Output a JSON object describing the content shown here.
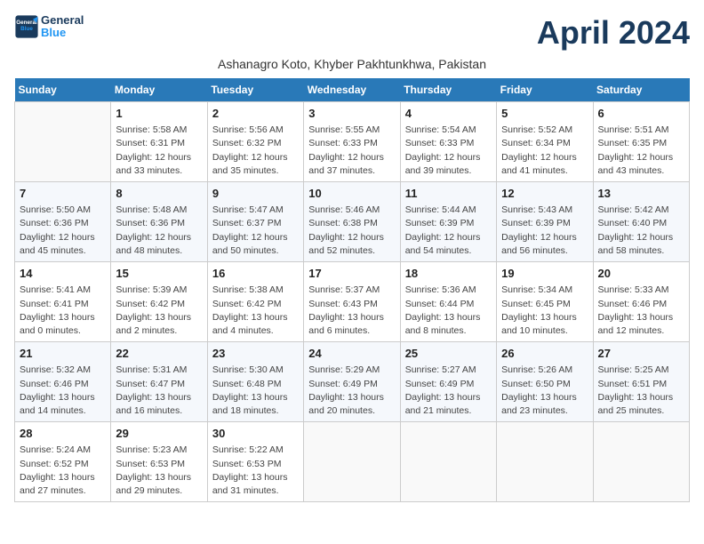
{
  "header": {
    "logo_line1": "General",
    "logo_line2": "Blue",
    "month_title": "April 2024",
    "subtitle": "Ashanagro Koto, Khyber Pakhtunkhwa, Pakistan"
  },
  "columns": [
    "Sunday",
    "Monday",
    "Tuesday",
    "Wednesday",
    "Thursday",
    "Friday",
    "Saturday"
  ],
  "weeks": [
    [
      {
        "day": "",
        "info": ""
      },
      {
        "day": "1",
        "info": "Sunrise: 5:58 AM\nSunset: 6:31 PM\nDaylight: 12 hours\nand 33 minutes."
      },
      {
        "day": "2",
        "info": "Sunrise: 5:56 AM\nSunset: 6:32 PM\nDaylight: 12 hours\nand 35 minutes."
      },
      {
        "day": "3",
        "info": "Sunrise: 5:55 AM\nSunset: 6:33 PM\nDaylight: 12 hours\nand 37 minutes."
      },
      {
        "day": "4",
        "info": "Sunrise: 5:54 AM\nSunset: 6:33 PM\nDaylight: 12 hours\nand 39 minutes."
      },
      {
        "day": "5",
        "info": "Sunrise: 5:52 AM\nSunset: 6:34 PM\nDaylight: 12 hours\nand 41 minutes."
      },
      {
        "day": "6",
        "info": "Sunrise: 5:51 AM\nSunset: 6:35 PM\nDaylight: 12 hours\nand 43 minutes."
      }
    ],
    [
      {
        "day": "7",
        "info": "Sunrise: 5:50 AM\nSunset: 6:36 PM\nDaylight: 12 hours\nand 45 minutes."
      },
      {
        "day": "8",
        "info": "Sunrise: 5:48 AM\nSunset: 6:36 PM\nDaylight: 12 hours\nand 48 minutes."
      },
      {
        "day": "9",
        "info": "Sunrise: 5:47 AM\nSunset: 6:37 PM\nDaylight: 12 hours\nand 50 minutes."
      },
      {
        "day": "10",
        "info": "Sunrise: 5:46 AM\nSunset: 6:38 PM\nDaylight: 12 hours\nand 52 minutes."
      },
      {
        "day": "11",
        "info": "Sunrise: 5:44 AM\nSunset: 6:39 PM\nDaylight: 12 hours\nand 54 minutes."
      },
      {
        "day": "12",
        "info": "Sunrise: 5:43 AM\nSunset: 6:39 PM\nDaylight: 12 hours\nand 56 minutes."
      },
      {
        "day": "13",
        "info": "Sunrise: 5:42 AM\nSunset: 6:40 PM\nDaylight: 12 hours\nand 58 minutes."
      }
    ],
    [
      {
        "day": "14",
        "info": "Sunrise: 5:41 AM\nSunset: 6:41 PM\nDaylight: 13 hours\nand 0 minutes."
      },
      {
        "day": "15",
        "info": "Sunrise: 5:39 AM\nSunset: 6:42 PM\nDaylight: 13 hours\nand 2 minutes."
      },
      {
        "day": "16",
        "info": "Sunrise: 5:38 AM\nSunset: 6:42 PM\nDaylight: 13 hours\nand 4 minutes."
      },
      {
        "day": "17",
        "info": "Sunrise: 5:37 AM\nSunset: 6:43 PM\nDaylight: 13 hours\nand 6 minutes."
      },
      {
        "day": "18",
        "info": "Sunrise: 5:36 AM\nSunset: 6:44 PM\nDaylight: 13 hours\nand 8 minutes."
      },
      {
        "day": "19",
        "info": "Sunrise: 5:34 AM\nSunset: 6:45 PM\nDaylight: 13 hours\nand 10 minutes."
      },
      {
        "day": "20",
        "info": "Sunrise: 5:33 AM\nSunset: 6:46 PM\nDaylight: 13 hours\nand 12 minutes."
      }
    ],
    [
      {
        "day": "21",
        "info": "Sunrise: 5:32 AM\nSunset: 6:46 PM\nDaylight: 13 hours\nand 14 minutes."
      },
      {
        "day": "22",
        "info": "Sunrise: 5:31 AM\nSunset: 6:47 PM\nDaylight: 13 hours\nand 16 minutes."
      },
      {
        "day": "23",
        "info": "Sunrise: 5:30 AM\nSunset: 6:48 PM\nDaylight: 13 hours\nand 18 minutes."
      },
      {
        "day": "24",
        "info": "Sunrise: 5:29 AM\nSunset: 6:49 PM\nDaylight: 13 hours\nand 20 minutes."
      },
      {
        "day": "25",
        "info": "Sunrise: 5:27 AM\nSunset: 6:49 PM\nDaylight: 13 hours\nand 21 minutes."
      },
      {
        "day": "26",
        "info": "Sunrise: 5:26 AM\nSunset: 6:50 PM\nDaylight: 13 hours\nand 23 minutes."
      },
      {
        "day": "27",
        "info": "Sunrise: 5:25 AM\nSunset: 6:51 PM\nDaylight: 13 hours\nand 25 minutes."
      }
    ],
    [
      {
        "day": "28",
        "info": "Sunrise: 5:24 AM\nSunset: 6:52 PM\nDaylight: 13 hours\nand 27 minutes."
      },
      {
        "day": "29",
        "info": "Sunrise: 5:23 AM\nSunset: 6:53 PM\nDaylight: 13 hours\nand 29 minutes."
      },
      {
        "day": "30",
        "info": "Sunrise: 5:22 AM\nSunset: 6:53 PM\nDaylight: 13 hours\nand 31 minutes."
      },
      {
        "day": "",
        "info": ""
      },
      {
        "day": "",
        "info": ""
      },
      {
        "day": "",
        "info": ""
      },
      {
        "day": "",
        "info": ""
      }
    ]
  ]
}
